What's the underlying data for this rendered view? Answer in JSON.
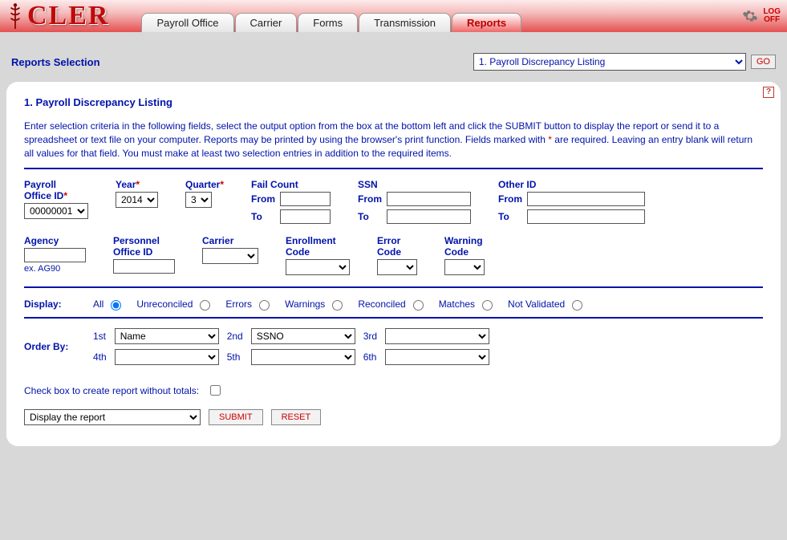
{
  "app": {
    "logo_text": "CLER"
  },
  "tabs": {
    "items": [
      "Payroll Office",
      "Carrier",
      "Forms",
      "Transmission",
      "Reports"
    ],
    "active_index": 4
  },
  "logoff": {
    "line1": "LOG",
    "line2": "OFF"
  },
  "subheader": {
    "title": "Reports Selection",
    "selected_report": "1. Payroll Discrepancy Listing",
    "go_label": "GO"
  },
  "panel": {
    "title": "1. Payroll Discrepancy Listing",
    "instructions_pre": "  Enter selection criteria in the following fields, select the output option from the box at the bottom left and click the SUBMIT button to display the report or send it to a spreadsheet or text file on your computer.  Reports may be printed by using the browser's print function.  Fields marked with ",
    "instructions_mid": "*",
    "instructions_post": " are required.  Leaving an entry blank will return all values for that field.  You must make at least two selection entries in addition to the required items.",
    "help_tooltip": "?"
  },
  "fields": {
    "payroll_office_id": {
      "label": "Payroll\nOffice ID",
      "value": "00000001"
    },
    "year": {
      "label": "Year",
      "value": "2014"
    },
    "quarter": {
      "label": "Quarter",
      "value": "3"
    },
    "fail_count": {
      "label": "Fail Count",
      "from_label": "From",
      "to_label": "To",
      "from_value": "",
      "to_value": ""
    },
    "ssn": {
      "label": "SSN",
      "from_label": "From",
      "to_label": "To",
      "from_value": "",
      "to_value": ""
    },
    "other_id": {
      "label": "Other ID",
      "from_label": "From",
      "to_label": "To",
      "from_value": "",
      "to_value": ""
    },
    "agency": {
      "label": "Agency",
      "value": "",
      "hint": "ex. AG90"
    },
    "personnel_office_id": {
      "label": "Personnel\nOffice ID",
      "value": ""
    },
    "carrier": {
      "label": "Carrier",
      "value": ""
    },
    "enrollment_code": {
      "label": "Enrollment\nCode",
      "value": ""
    },
    "error_code": {
      "label": "Error\nCode",
      "value": ""
    },
    "warning_code": {
      "label": "Warning\nCode",
      "value": ""
    }
  },
  "display": {
    "label": "Display:",
    "options": [
      "All",
      "Unreconciled",
      "Errors",
      "Warnings",
      "Reconciled",
      "Matches",
      "Not Validated"
    ],
    "selected_index": 0
  },
  "order_by": {
    "label": "Order By:",
    "labels": [
      "1st",
      "2nd",
      "3rd",
      "4th",
      "5th",
      "6th"
    ],
    "values": [
      "Name",
      "SSNO",
      "",
      "",
      "",
      ""
    ]
  },
  "totals": {
    "label": "Check box to create report without totals:",
    "checked": false
  },
  "actions": {
    "output_option": "Display the report",
    "submit_label": "SUBMIT",
    "reset_label": "RESET"
  }
}
